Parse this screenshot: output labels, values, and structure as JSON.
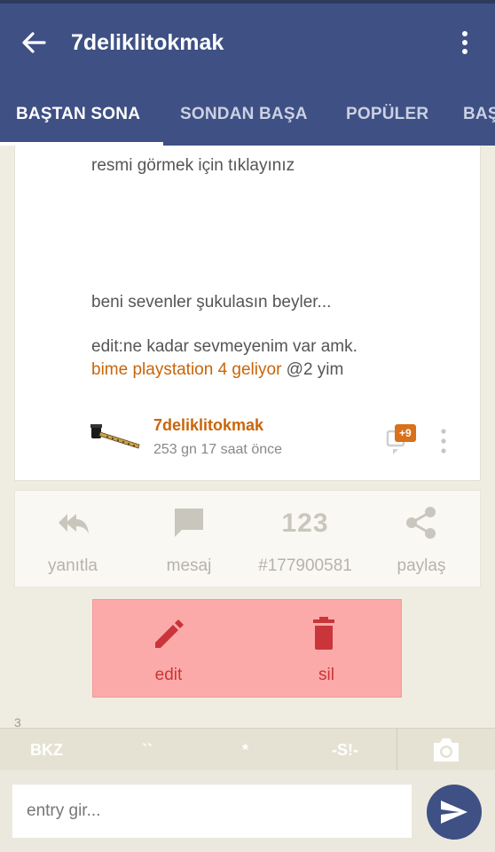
{
  "app": {
    "title": "7deliklitokmak",
    "tabs": [
      "BAŞTAN SONA",
      "SONDAN BAŞA",
      "POPÜLER",
      "BAŞ"
    ]
  },
  "entry": {
    "image_link": "resmi görmek için tıklayınız",
    "text_line1": "beni sevenler şukulasın beyler...",
    "text_line2": "edit:ne kadar sevmeyenim var amk.",
    "link2": "bime playstation 4 geliyor",
    "mention": "@2 yim",
    "author": "7deliklitokmak",
    "time": "253 gn 17 saat  önce",
    "badge": "+9"
  },
  "actions": {
    "reply": "yanıtla",
    "message": "mesaj",
    "id_number": "123",
    "entry_id": "#177900581",
    "share": "paylaş"
  },
  "owner_actions": {
    "edit": "edit",
    "delete": "sil"
  },
  "peek_number": "3",
  "toolbar": {
    "bkz": "BKZ",
    "backtick": "``",
    "star": "*",
    "spoiler": "-S!-"
  },
  "input": {
    "placeholder": "entry gir..."
  },
  "colors": {
    "appbar": "#3e5084",
    "link": "#c9650b",
    "owner_bg": "#fcaaa9",
    "owner_text": "#c9353a"
  }
}
